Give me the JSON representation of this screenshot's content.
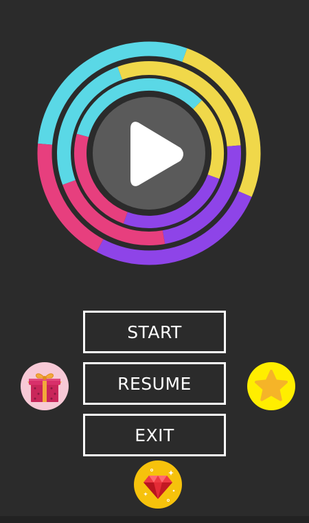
{
  "game": {
    "logo_icon": "play-button-ring-icon",
    "ring_colors": {
      "cyan": "#5ad8e6",
      "yellow": "#f0d84a",
      "pink": "#e73f7e",
      "purple": "#8e44e8",
      "center": "#5a5a5a",
      "background": "#2b2b2b"
    }
  },
  "menu": {
    "start_label": "START",
    "resume_label": "RESUME",
    "exit_label": "EXIT"
  },
  "side_icons": {
    "gift": "gift-icon",
    "star": "star-icon",
    "gem": "ruby-gem-icon"
  }
}
